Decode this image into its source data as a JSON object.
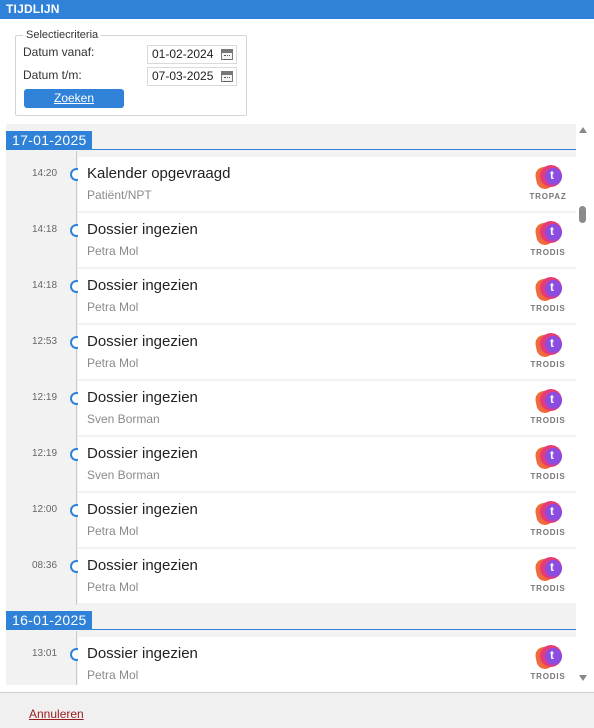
{
  "window": {
    "title": "TIJDLIJN"
  },
  "criteria": {
    "legend": "Selectiecriteria",
    "from_label": "Datum vanaf:",
    "from_value": "01-02-2024",
    "to_label": "Datum t/m:",
    "to_value": "07-03-2025",
    "search_label": "Zoeken"
  },
  "groups": [
    {
      "date": "17-01-2025",
      "entries": [
        {
          "time": "14:20",
          "title": "Kalender opgevraagd",
          "sub": "Patiënt/NPT",
          "source": "TROPAZ"
        },
        {
          "time": "14:18",
          "title": "Dossier ingezien",
          "sub": "Petra Mol",
          "source": "TRODIS"
        },
        {
          "time": "14:18",
          "title": "Dossier ingezien",
          "sub": "Petra Mol",
          "source": "TRODIS"
        },
        {
          "time": "12:53",
          "title": "Dossier ingezien",
          "sub": "Petra Mol",
          "source": "TRODIS"
        },
        {
          "time": "12:19",
          "title": "Dossier ingezien",
          "sub": "Sven Borman",
          "source": "TRODIS"
        },
        {
          "time": "12:19",
          "title": "Dossier ingezien",
          "sub": "Sven Borman",
          "source": "TRODIS"
        },
        {
          "time": "12:00",
          "title": "Dossier ingezien",
          "sub": "Petra Mol",
          "source": "TRODIS"
        },
        {
          "time": "08:36",
          "title": "Dossier ingezien",
          "sub": "Petra Mol",
          "source": "TRODIS"
        }
      ]
    },
    {
      "date": "16-01-2025",
      "entries": [
        {
          "time": "13:01",
          "title": "Dossier ingezien",
          "sub": "Petra Mol",
          "source": "TRODIS"
        }
      ]
    }
  ],
  "footer": {
    "cancel_label": "Annuleren"
  },
  "colors": {
    "accent": "#2f82d8",
    "cancel": "#9b1c1c"
  },
  "icons": {
    "date_picker": "calendar-icon",
    "source_logo": "t-logo-icon",
    "scroll_up": "arrow-up-icon",
    "scroll_down": "arrow-down-icon"
  }
}
